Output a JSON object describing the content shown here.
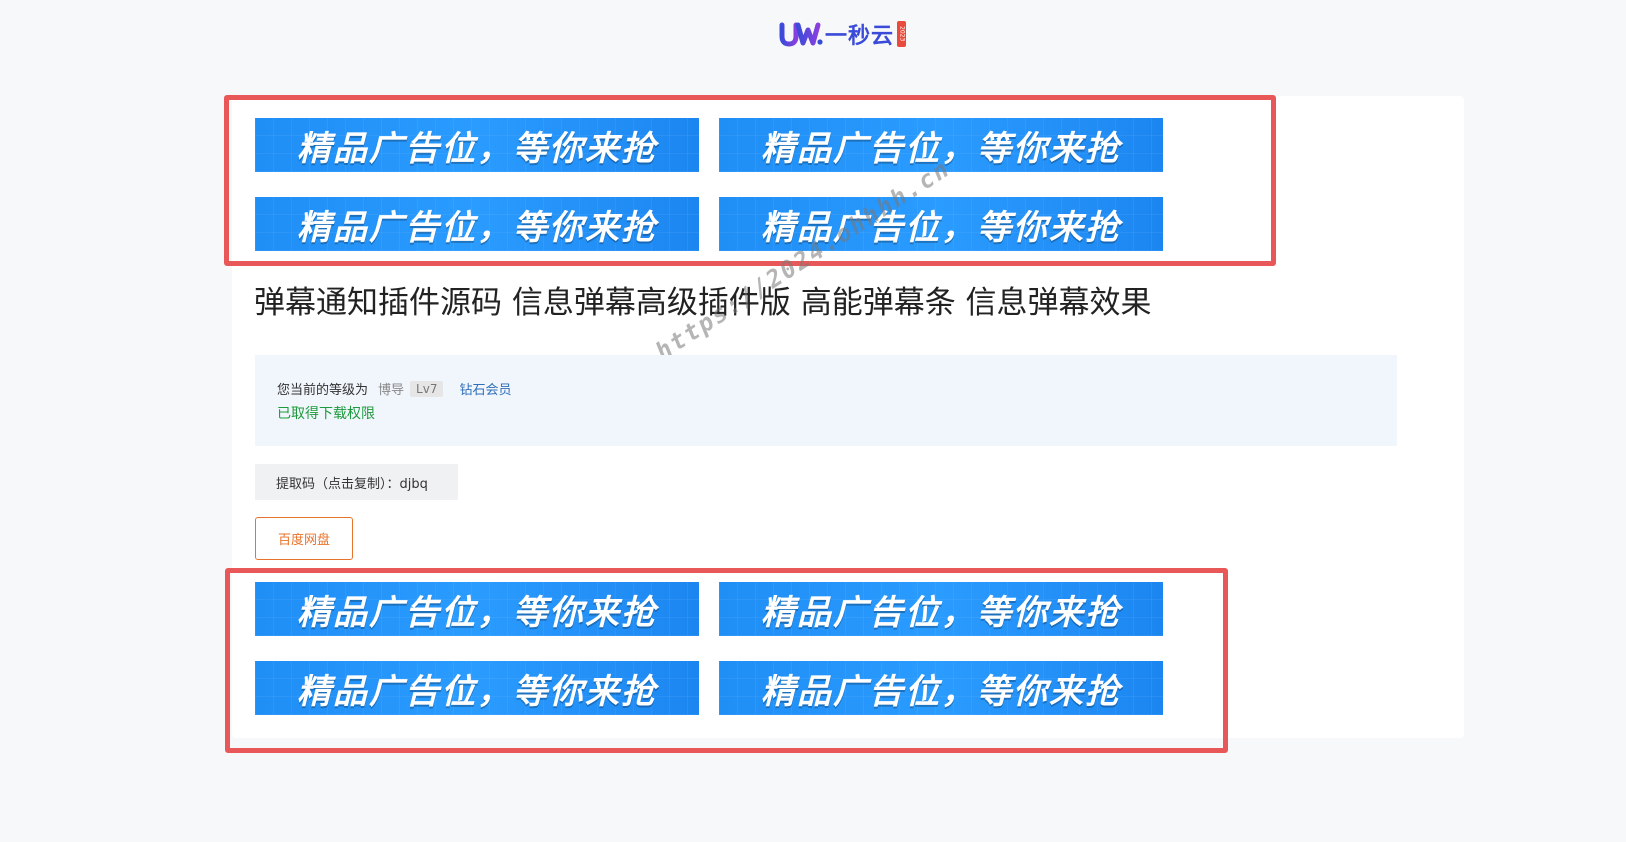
{
  "header": {
    "logo_mark": "UU.",
    "logo_text": "一秒云",
    "logo_stamp": "2023"
  },
  "ads": {
    "top": [
      "精品广告位，等你来抢",
      "精品广告位，等你来抢",
      "精品广告位，等你来抢",
      "精品广告位，等你来抢"
    ],
    "bottom": [
      "精品广告位，等你来抢",
      "精品广告位，等你来抢",
      "精品广告位，等你来抢",
      "精品广告位，等你来抢"
    ]
  },
  "post": {
    "title": "弹幕通知插件源码 信息弹幕高级插件版 高能弹幕条 信息弹幕效果",
    "watermark": "https://2024.ohhhh.cn"
  },
  "user_info": {
    "level_prefix": "您当前的等级为",
    "level_name": "博导",
    "level_badge": "Lv7",
    "vip_label": "钻石会员",
    "download_status": "已取得下载权限"
  },
  "download": {
    "extract_code_label": "提取码（点击复制）：djbq",
    "pan_button": "百度网盘"
  },
  "colors": {
    "highlight": "#e85858",
    "ad_blue": "#2a9bff",
    "success": "#1d9a3c",
    "button_orange": "#e8732a",
    "logo_blue": "#3a4bd9"
  }
}
